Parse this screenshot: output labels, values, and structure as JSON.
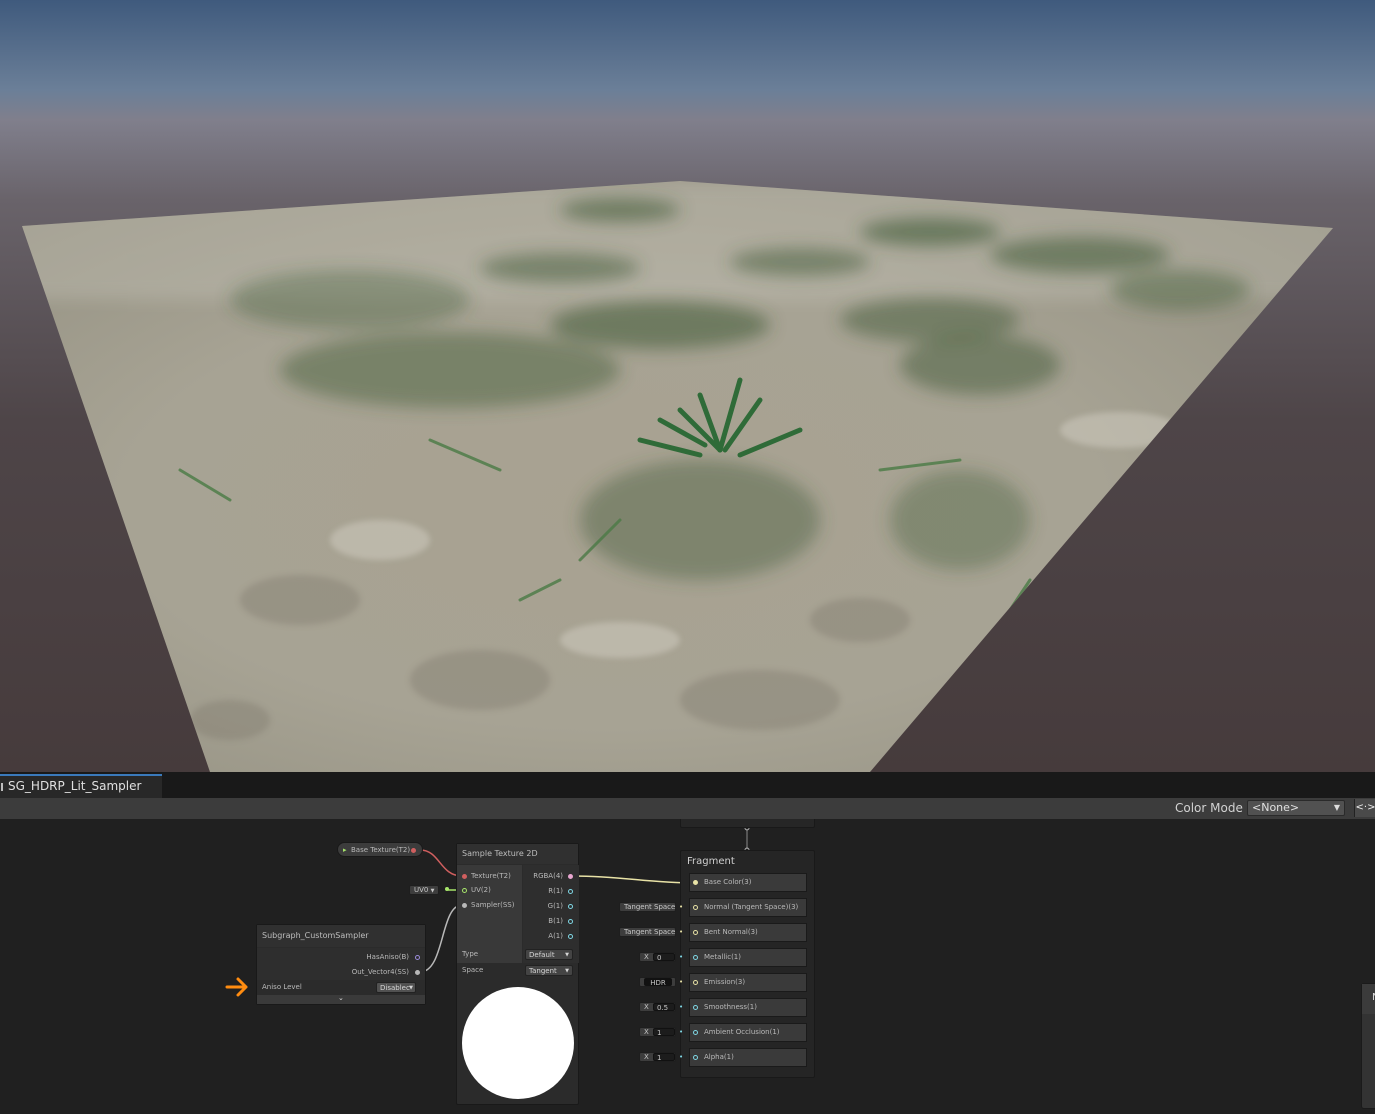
{
  "colors": {
    "accent_tab": "#3a79bb",
    "texture_wire": "#d05f5f",
    "vector_wire": "#e8e2a6",
    "float_wire": "#7fd7e5",
    "uv_wire": "#a7e56b",
    "sampler_wire": "#b8b8b8",
    "annotation_arrow": "#ff8c10"
  },
  "window": {
    "tab_title": "SG_HDRP_Lit_Sampler"
  },
  "toolbar": {
    "color_mode_label": "Color Mode",
    "color_mode_value": "<None>",
    "toggle_icon": "<·>"
  },
  "graph": {
    "property_node": {
      "label": "Base Texture(T2)"
    },
    "subgraph_node": {
      "title": "Subgraph_CustomSampler",
      "outputs": [
        "HasAniso(B)",
        "Out_Vector4(SS)"
      ],
      "aniso_label": "Aniso Level",
      "aniso_value": "Disablec"
    },
    "sample_texture_node": {
      "title": "Sample Texture 2D",
      "inputs": [
        "Texture(T2)",
        "UV(2)",
        "Sampler(SS)"
      ],
      "outputs": [
        "RGBA(4)",
        "R(1)",
        "G(1)",
        "B(1)",
        "A(1)"
      ],
      "uv_dropdown": "UV0",
      "type_label": "Type",
      "type_value": "Default",
      "space_label": "Space",
      "space_value": "Tangent"
    },
    "fragment": {
      "title": "Fragment",
      "slots": [
        "Base Color(3)",
        "Normal (Tangent Space)(3)",
        "Bent Normal(3)",
        "Metallic(1)",
        "Emission(3)",
        "Smoothness(1)",
        "Ambient Occlusion(1)",
        "Alpha(1)"
      ],
      "inputs": [
        {
          "prefix": "",
          "value": ""
        },
        {
          "prefix": "",
          "value": "Tangent Space"
        },
        {
          "prefix": "",
          "value": "Tangent Space"
        },
        {
          "prefix": "X",
          "value": "0"
        },
        {
          "prefix": "",
          "value": "HDR"
        },
        {
          "prefix": "X",
          "value": "0.5"
        },
        {
          "prefix": "X",
          "value": "1"
        },
        {
          "prefix": "X",
          "value": "1"
        }
      ]
    },
    "side_panel": {
      "label": "N"
    }
  }
}
